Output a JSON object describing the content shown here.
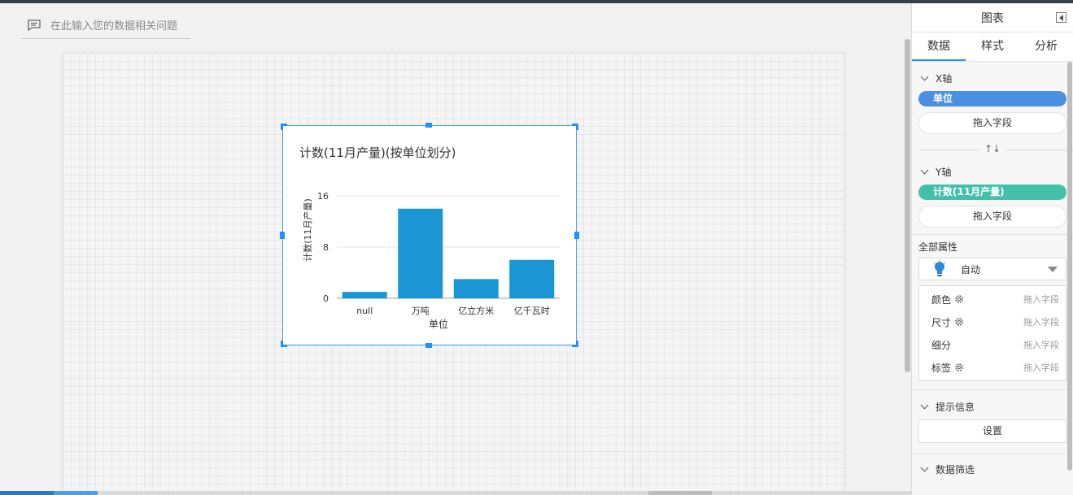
{
  "query": {
    "placeholder": "在此输入您的数据相关问题"
  },
  "panel": {
    "title": "图表",
    "tabs": [
      {
        "label": "数据"
      },
      {
        "label": "样式"
      },
      {
        "label": "分析"
      }
    ],
    "x_axis": {
      "title": "X轴",
      "field": "单位",
      "drop": "拖入字段",
      "color": "#4a90e2"
    },
    "y_axis": {
      "title": "Y轴",
      "field": "计数(11月产量)",
      "drop": "拖入字段",
      "color": "#45c0a8"
    },
    "swap_icon": "↑↓",
    "all_props": {
      "title": "全部属性",
      "mode": "自动",
      "rows": [
        {
          "label": "颜色",
          "drop": "拖入字段",
          "gear": true
        },
        {
          "label": "尺寸",
          "drop": "拖入字段",
          "gear": true
        },
        {
          "label": "细分",
          "drop": "拖入字段",
          "gear": false
        },
        {
          "label": "标签",
          "drop": "拖入字段",
          "gear": true
        }
      ]
    },
    "tooltip": {
      "title": "提示信息",
      "button": "设置"
    },
    "filter": {
      "title": "数据筛选"
    }
  },
  "chart_data": {
    "type": "bar",
    "title": "计数(11月产量)(按单位划分)",
    "xlabel": "单位",
    "ylabel": "计数(11月产量)",
    "categories": [
      "null",
      "万吨",
      "亿立方米",
      "亿千瓦时"
    ],
    "values": [
      1,
      14,
      3,
      6
    ],
    "ylim": [
      0,
      16
    ],
    "yticks": [
      0,
      8,
      16
    ],
    "color": "#1a96d4",
    "grid": true
  }
}
